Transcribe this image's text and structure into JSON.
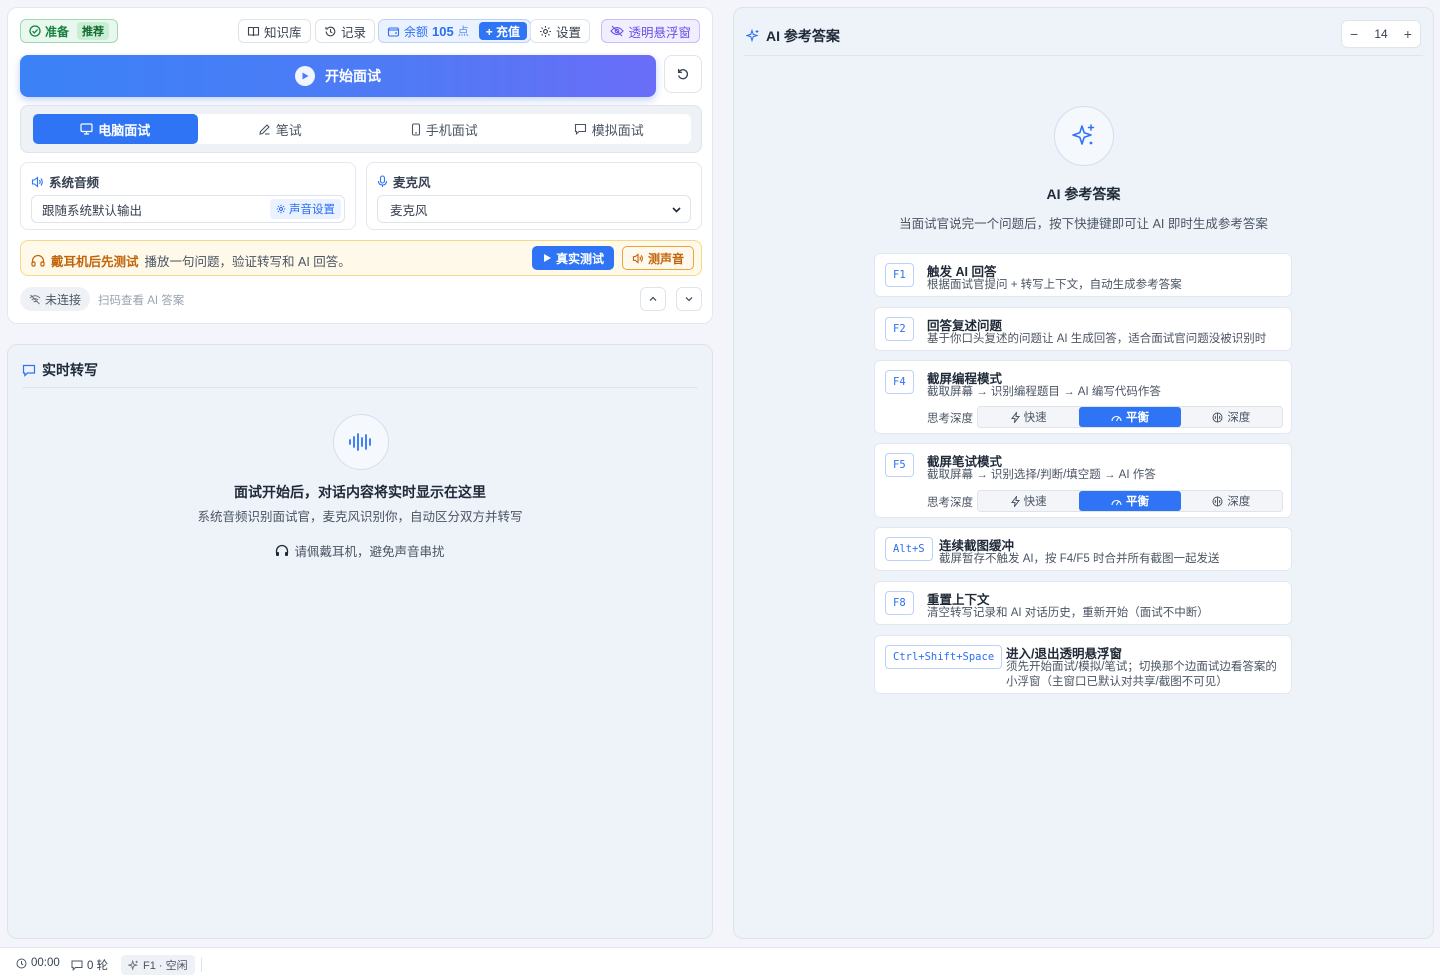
{
  "toolbar": {
    "ready_label": "准备",
    "ready_tag": "推荐",
    "knowledge_label": "知识库",
    "records_label": "记录",
    "balance_label": "余额",
    "balance_value": "105",
    "balance_unit": "点",
    "recharge_label": "+ 充值",
    "settings_label": "设置",
    "float_window_label": "透明悬浮窗"
  },
  "start_button_label": "开始面试",
  "mode_tabs": [
    {
      "label": "电脑面试",
      "icon": "monitor-icon",
      "active": true
    },
    {
      "label": "笔试",
      "icon": "pen-icon",
      "active": false
    },
    {
      "label": "手机面试",
      "icon": "phone-icon",
      "active": false
    },
    {
      "label": "模拟面试",
      "icon": "chat-icon",
      "active": false
    }
  ],
  "system_audio": {
    "title": "系统音频",
    "value": "跟随系统默认输出",
    "settings_label": "声音设置"
  },
  "microphone": {
    "title": "麦克风",
    "selected": "麦克风"
  },
  "test_banner": {
    "strong": "戴耳机后先测试",
    "text": "播放一句问题，验证转写和 AI 回答。",
    "real_test_label": "真实测试",
    "sound_test_label": "测声音"
  },
  "connection": {
    "status": "未连接",
    "hint": "扫码查看 AI 答案"
  },
  "transcript": {
    "title": "实时转写",
    "empty_title": "面试开始后，对话内容将实时显示在这里",
    "empty_sub": "系统音频识别面试官，麦克风识别你，自动区分双方并转写",
    "hint": "请佩戴耳机，避免声音串扰"
  },
  "answer_panel": {
    "title": "AI 参考答案",
    "font_size": "14",
    "empty_title": "AI 参考答案",
    "empty_sub": "当面试官说完一个问题后，按下快捷键即可让 AI 即时生成参考答案",
    "depth_label": "思考深度",
    "depth_options": [
      "快速",
      "平衡",
      "深度"
    ],
    "shortcuts": [
      {
        "key": "F1",
        "title": "触发 AI 回答",
        "desc": "根据面试官提问 + 转写上下文，自动生成参考答案"
      },
      {
        "key": "F2",
        "title": "回答复述问题",
        "desc": "基于你口头复述的问题让 AI 生成回答，适合面试官问题没被识别时"
      },
      {
        "key": "F4",
        "title": "截屏编程模式",
        "desc": "截取屏幕 → 识别编程题目 → AI 编写代码作答"
      },
      {
        "key": "F5",
        "title": "截屏笔试模式",
        "desc": "截取屏幕 → 识别选择/判断/填空题 → AI 作答"
      },
      {
        "key": "Alt+S",
        "title": "连续截图缓冲",
        "desc": "截屏暂存不触发 AI，按 F4/F5 时合并所有截图一起发送"
      },
      {
        "key": "F8",
        "title": "重置上下文",
        "desc": "清空转写记录和 AI 对话历史，重新开始（面试不中断）"
      },
      {
        "key": "Ctrl+Shift+Space",
        "title": "进入/退出透明悬浮窗",
        "desc": "须先开始面试/模拟/笔试；切换那个边面试边看答案的小浮窗（主窗口已默认对共享/截图不可见）"
      }
    ]
  },
  "statusbar": {
    "time": "00:00",
    "rounds": "0 轮",
    "state": "F1 · 空闲"
  },
  "colors": {
    "primary": "#2f74f5",
    "success": "#16803c",
    "warning": "#c2650a",
    "purple": "#6d4fe6"
  }
}
